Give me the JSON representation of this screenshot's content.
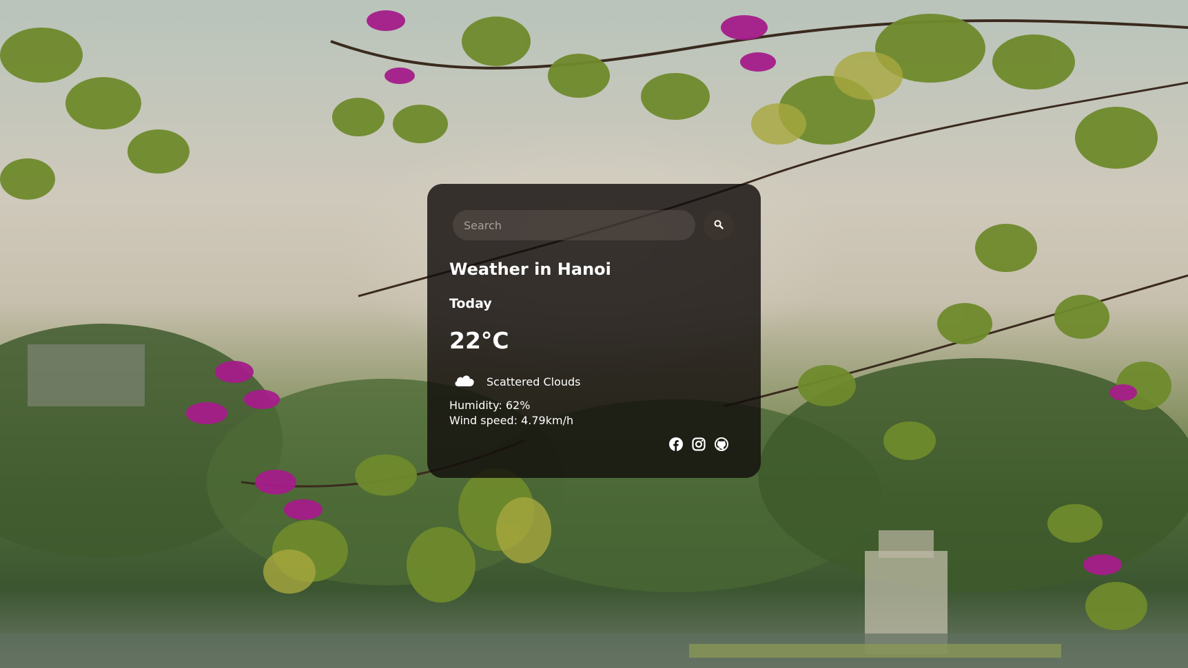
{
  "search": {
    "placeholder": "Search",
    "value": ""
  },
  "weather": {
    "title": "Weather in Hanoi",
    "day": "Today",
    "temperature": "22°C",
    "condition": "Scattered Clouds",
    "condition_icon": "cloud-icon",
    "humidity": "Humidity: 62%",
    "wind": "Wind speed: 4.79km/h"
  },
  "socials": [
    {
      "icon": "facebook-icon"
    },
    {
      "icon": "instagram-icon"
    },
    {
      "icon": "github-icon"
    }
  ],
  "colors": {
    "card_background": "#120e0c",
    "text": "#ffffff",
    "search_field": "#5a504a",
    "placeholder": "#a8a09a"
  }
}
